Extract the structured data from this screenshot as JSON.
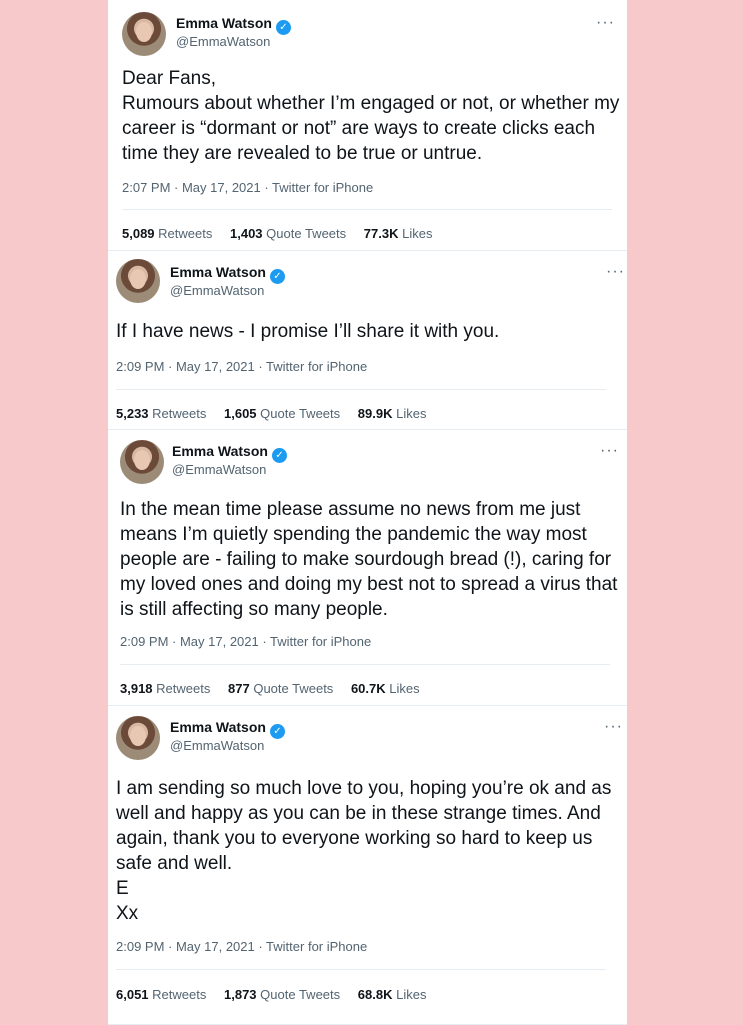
{
  "tweets": [
    {
      "name": "Emma Watson",
      "handle": "@EmmaWatson",
      "text": "Dear Fans,\nRumours about whether I’m engaged or not, or whether my career is “dormant or not” are ways to create clicks each time they are revealed to be true or untrue.",
      "meta": "2:07 PM · May 17, 2021 · Twitter for iPhone",
      "retweets": "5,089",
      "retweets_label": "Retweets",
      "quotes": "1,403",
      "quotes_label": "Quote Tweets",
      "likes": "77.3K",
      "likes_label": "Likes"
    },
    {
      "name": "Emma Watson",
      "handle": "@EmmaWatson",
      "text": "If I have news - I promise I’ll share it with you.",
      "meta": "2:09 PM · May 17, 2021 · Twitter for iPhone",
      "retweets": "5,233",
      "retweets_label": "Retweets",
      "quotes": "1,605",
      "quotes_label": "Quote Tweets",
      "likes": "89.9K",
      "likes_label": "Likes"
    },
    {
      "name": "Emma Watson",
      "handle": "@EmmaWatson",
      "text": "In the mean time please assume no news from me just means I’m quietly spending the pandemic the way most people are - failing to make sourdough bread (!), caring for my loved ones and doing my best not to spread a virus that is still affecting so many people.",
      "meta": "2:09 PM · May 17, 2021 · Twitter for iPhone",
      "retweets": "3,918",
      "retweets_label": "Retweets",
      "quotes": "877",
      "quotes_label": "Quote Tweets",
      "likes": "60.7K",
      "likes_label": "Likes"
    },
    {
      "name": "Emma Watson",
      "handle": "@EmmaWatson",
      "text": "I am sending so much love to you, hoping you’re ok and as well and happy as you can be in these strange times. And again, thank you to everyone working so hard to keep us safe and well.\nE\nXx",
      "meta": "2:09 PM · May 17, 2021 · Twitter for iPhone",
      "retweets": "6,051",
      "retweets_label": "Retweets",
      "quotes": "1,873",
      "quotes_label": "Quote Tweets",
      "likes": "68.8K",
      "likes_label": "Likes"
    }
  ],
  "icons": {
    "verified": "verified-badge-icon",
    "more": "more-options-icon"
  },
  "colors": {
    "background": "#f7c9cb",
    "verified": "#1d9bf0",
    "secondary_text": "#536471"
  }
}
